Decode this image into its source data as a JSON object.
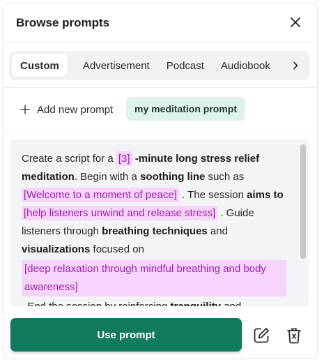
{
  "header": {
    "title": "Browse prompts",
    "close_icon": "close-icon"
  },
  "tabs": {
    "items": [
      {
        "label": "Custom",
        "active": true
      },
      {
        "label": "Advertisement",
        "active": false
      },
      {
        "label": "Podcast",
        "active": false
      },
      {
        "label": "Audiobook",
        "active": false
      }
    ],
    "more_icon": "chevron-right-icon"
  },
  "prompts": {
    "add_label": "Add new prompt",
    "selected_prompt": "my meditation prompt"
  },
  "prompt_body": {
    "t1": "Create a script for a ",
    "v1": "[3]",
    "b1": " -minute long stress relief meditation",
    "t2": ". Begin with a ",
    "b2": "soothing line",
    "t3": " such as ",
    "v2": "[Welcome to a moment of peace]",
    "t4": " . The session ",
    "b3": "aims to",
    "t5": " ",
    "v3": "[help listeners unwind and release stress]",
    "t6": " . Guide listeners through ",
    "b4": "breathing techniques",
    "t7": " and ",
    "b5": "visualizations",
    "t8": " focused on",
    "v4": "[deep relaxation through mindful breathing and body awareness]",
    "t9": " . End the session by reinforcing ",
    "b6": "tranquility",
    "t10": " and"
  },
  "footer": {
    "use_label": "Use prompt",
    "edit_icon": "edit-icon",
    "delete_icon": "trash-icon"
  },
  "colors": {
    "primary": "#127a5c",
    "chip_bg": "#dff3ec",
    "variable_bg": "#f7d4fb",
    "variable_text": "#9b1fb0"
  }
}
